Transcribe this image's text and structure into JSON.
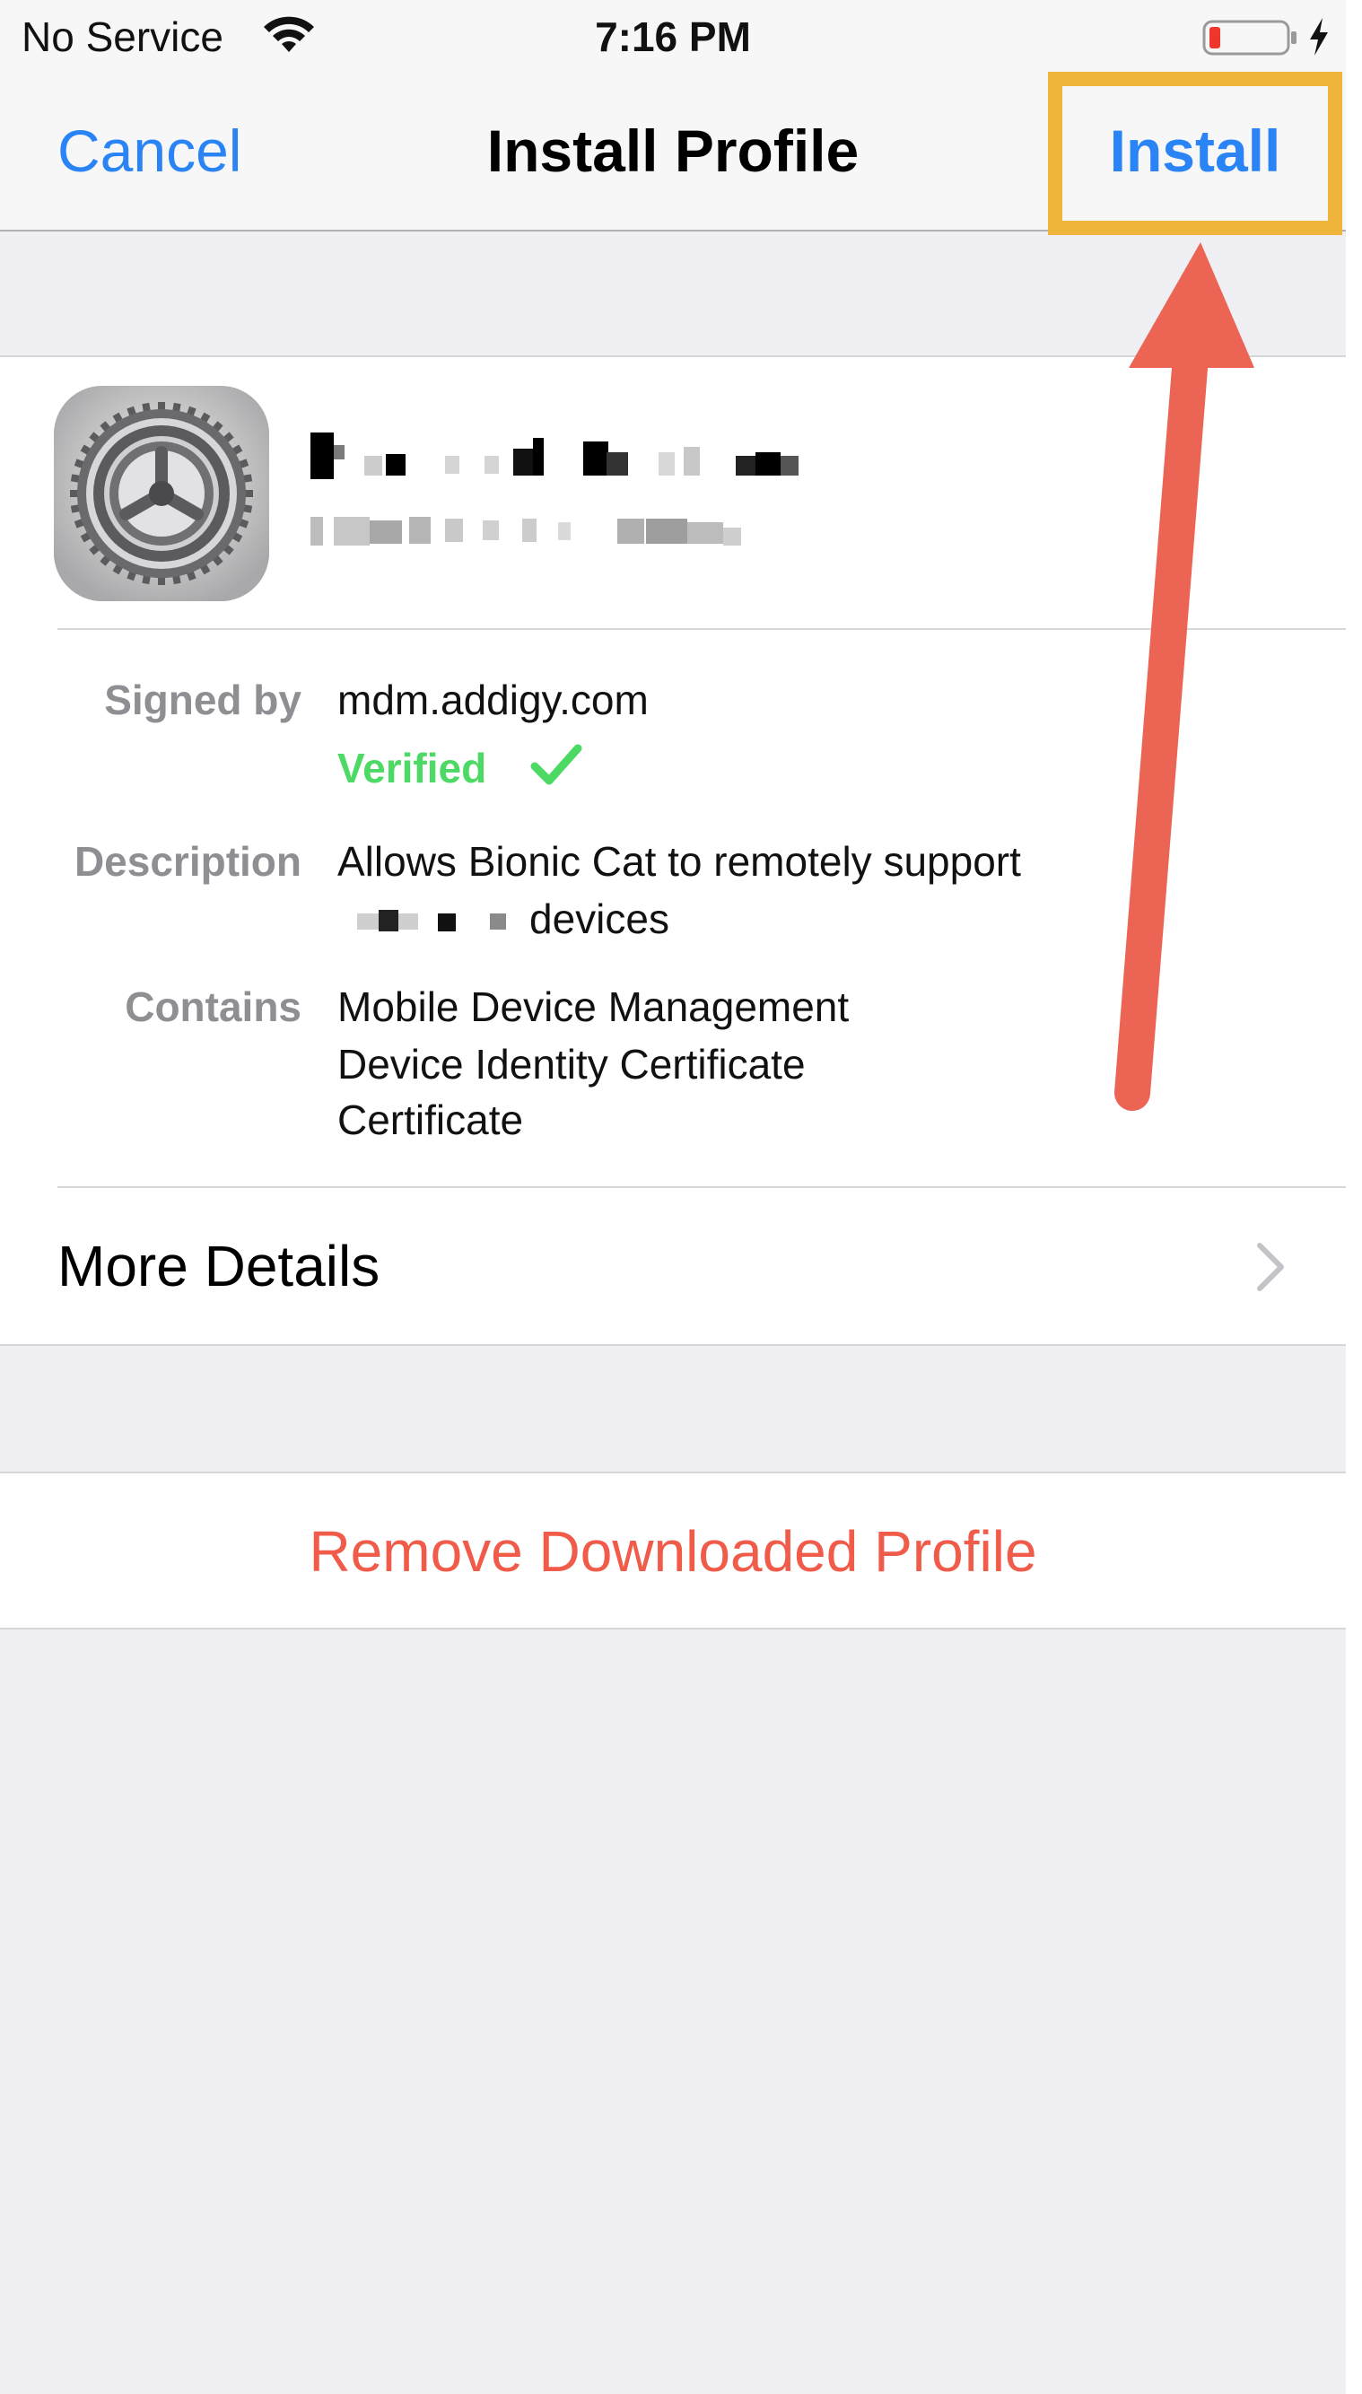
{
  "status_bar": {
    "carrier": "No Service",
    "time": "7:16 PM",
    "wifi_icon": "wifi-icon",
    "battery_icon": "battery-low-icon",
    "charge_icon": "charging-bolt-icon"
  },
  "nav": {
    "cancel_label": "Cancel",
    "title": "Install Profile",
    "install_label": "Install"
  },
  "profile": {
    "icon": "settings-gear-icon",
    "name": "",
    "subtitle": ""
  },
  "details": {
    "signed_by_label": "Signed by",
    "signed_by_value": "mdm.addigy.com",
    "verified_label": "Verified",
    "verified_icon": "checkmark-icon",
    "description_label": "Description",
    "description_line1": "Allows Bionic Cat to remotely support",
    "description_line2": "devices",
    "contains_label": "Contains",
    "contains_items": [
      "Mobile Device Management",
      "Device Identity Certificate",
      "Certificate"
    ]
  },
  "more_details": {
    "label": "More Details",
    "icon": "chevron-right-icon"
  },
  "remove": {
    "label": "Remove Downloaded Profile"
  },
  "colors": {
    "link_blue": "#2a84f5",
    "destructive_red": "#f15b49",
    "verified_green": "#4cd964",
    "highlight_yellow": "#f0b63c",
    "arrow_red": "#ec6453",
    "background": "#efeff4"
  },
  "annotations": {
    "highlight": "install-button-highlight",
    "arrow": "arrow-pointing-to-install"
  }
}
